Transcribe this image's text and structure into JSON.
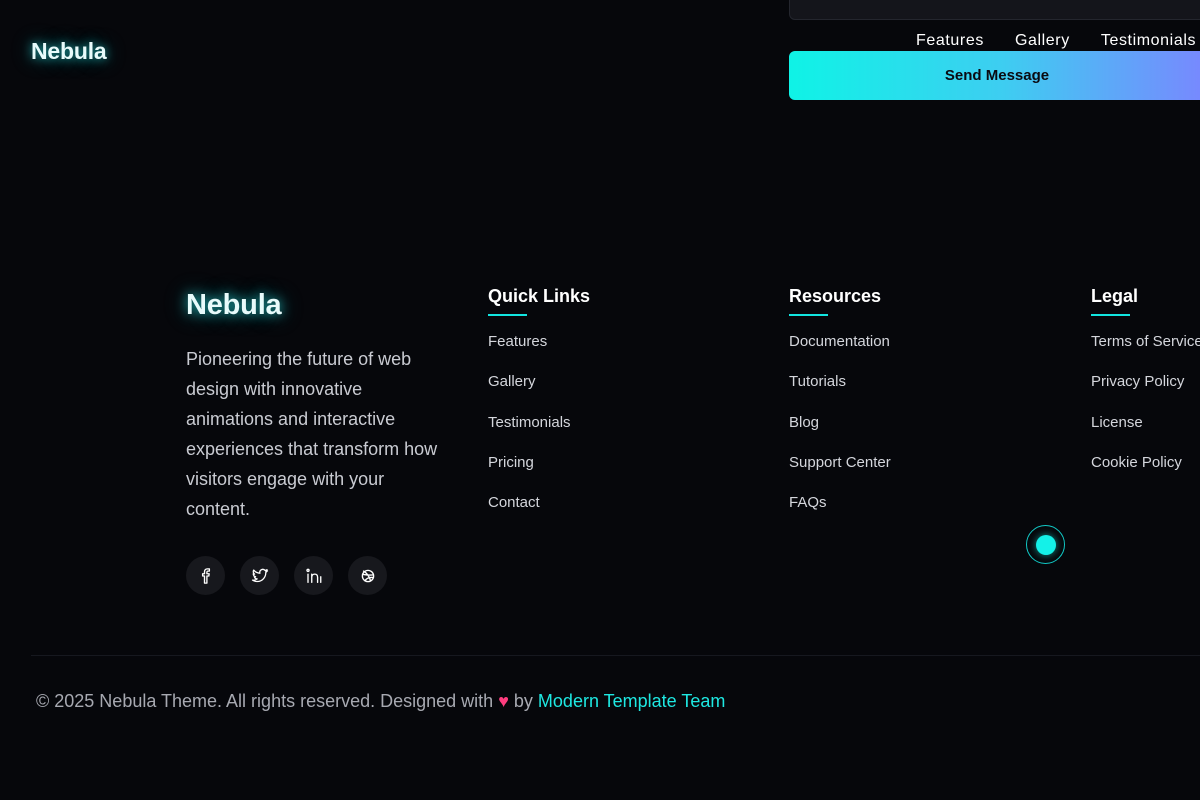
{
  "header": {
    "logo": "Nebula",
    "nav": [
      "Features",
      "Gallery",
      "Testimonials"
    ]
  },
  "contact_form": {
    "submit_label": "Send Message"
  },
  "footer": {
    "brand": {
      "logo": "Nebula",
      "description": "Pioneering the future of web design with innovative animations and interactive experiences that transform how visitors engage with your content.",
      "social": [
        {
          "name": "facebook-icon"
        },
        {
          "name": "twitter-icon"
        },
        {
          "name": "linkedin-icon"
        },
        {
          "name": "dribbble-icon"
        }
      ]
    },
    "quick_links": {
      "heading": "Quick Links",
      "items": [
        "Features",
        "Gallery",
        "Testimonials",
        "Pricing",
        "Contact"
      ]
    },
    "resources": {
      "heading": "Resources",
      "items": [
        "Documentation",
        "Tutorials",
        "Blog",
        "Support Center",
        "FAQs"
      ]
    },
    "legal": {
      "heading": "Legal",
      "items": [
        "Terms of Service",
        "Privacy Policy",
        "License",
        "Cookie Policy"
      ]
    },
    "copyright": {
      "prefix": "© 2025 Nebula Theme. All rights reserved. Designed with",
      "heart": "♥",
      "by": "by",
      "credit": "Modern Template Team"
    }
  },
  "colors": {
    "background": "#06070b",
    "accent": "#12e5e0",
    "gradient_start": "#0ff3e6",
    "gradient_end": "#7c83ff",
    "heart": "#ff3d7f"
  }
}
